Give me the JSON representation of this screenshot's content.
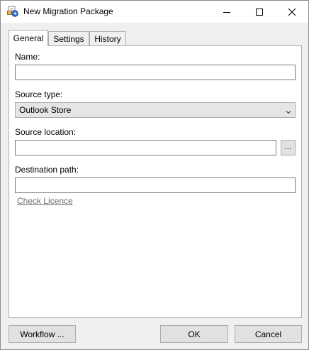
{
  "window": {
    "title": "New Migration Package",
    "icon": "package-migration-icon"
  },
  "titlebar_buttons": {
    "minimize_icon": "minimize-icon",
    "maximize_icon": "maximize-icon",
    "close_icon": "close-icon"
  },
  "tabs": [
    {
      "label": "General",
      "active": true
    },
    {
      "label": "Settings",
      "active": false
    },
    {
      "label": "History",
      "active": false
    }
  ],
  "form": {
    "name_label": "Name:",
    "name_value": "",
    "source_type_label": "Source type:",
    "source_type_value": "Outlook Store",
    "source_location_label": "Source location:",
    "source_location_value": "",
    "browse_label": "...",
    "destination_label": "Destination path:",
    "destination_value": "",
    "check_licence_label": "Check Licence"
  },
  "footer": {
    "workflow_label": "Workflow ...",
    "ok_label": "OK",
    "cancel_label": "Cancel"
  },
  "colors": {
    "link": "#6d6d6d",
    "window_bg": "#f0f0f0",
    "panel_bg": "#ffffff"
  }
}
